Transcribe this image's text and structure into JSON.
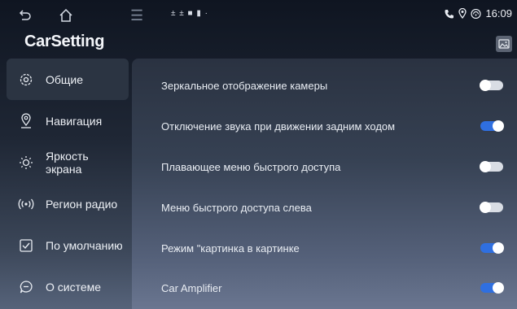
{
  "header": {
    "app_title": "CarSetting",
    "time": "16:09",
    "status_icons": "± ± ■ ▮ ·"
  },
  "sidebar": {
    "items": [
      {
        "label": "Общие",
        "icon": "gear-icon",
        "active": true
      },
      {
        "label": "Навигация",
        "icon": "location-pin-icon",
        "active": false
      },
      {
        "label": "Яркость экрана",
        "icon": "brightness-icon",
        "active": false
      },
      {
        "label": "Регион радио",
        "icon": "radio-signal-icon",
        "active": false
      },
      {
        "label": "По умолчанию",
        "icon": "checkbox-icon",
        "active": false
      },
      {
        "label": "О системе",
        "icon": "chat-info-icon",
        "active": false
      }
    ]
  },
  "settings": [
    {
      "label": "Зеркальное отображение камеры",
      "enabled": false
    },
    {
      "label": "Отключение звука при движении задним ходом",
      "enabled": true
    },
    {
      "label": "Плавающее меню быстрого доступа",
      "enabled": false
    },
    {
      "label": "Меню быстрого доступа слева",
      "enabled": false
    },
    {
      "label": "Режим \"картинка в картинке",
      "enabled": true
    },
    {
      "label": "Car Amplifier",
      "enabled": true
    }
  ],
  "colors": {
    "toggle_on": "#2f6fe0",
    "toggle_off": "#d9dde4",
    "active_sidebar": "#2b3442"
  }
}
